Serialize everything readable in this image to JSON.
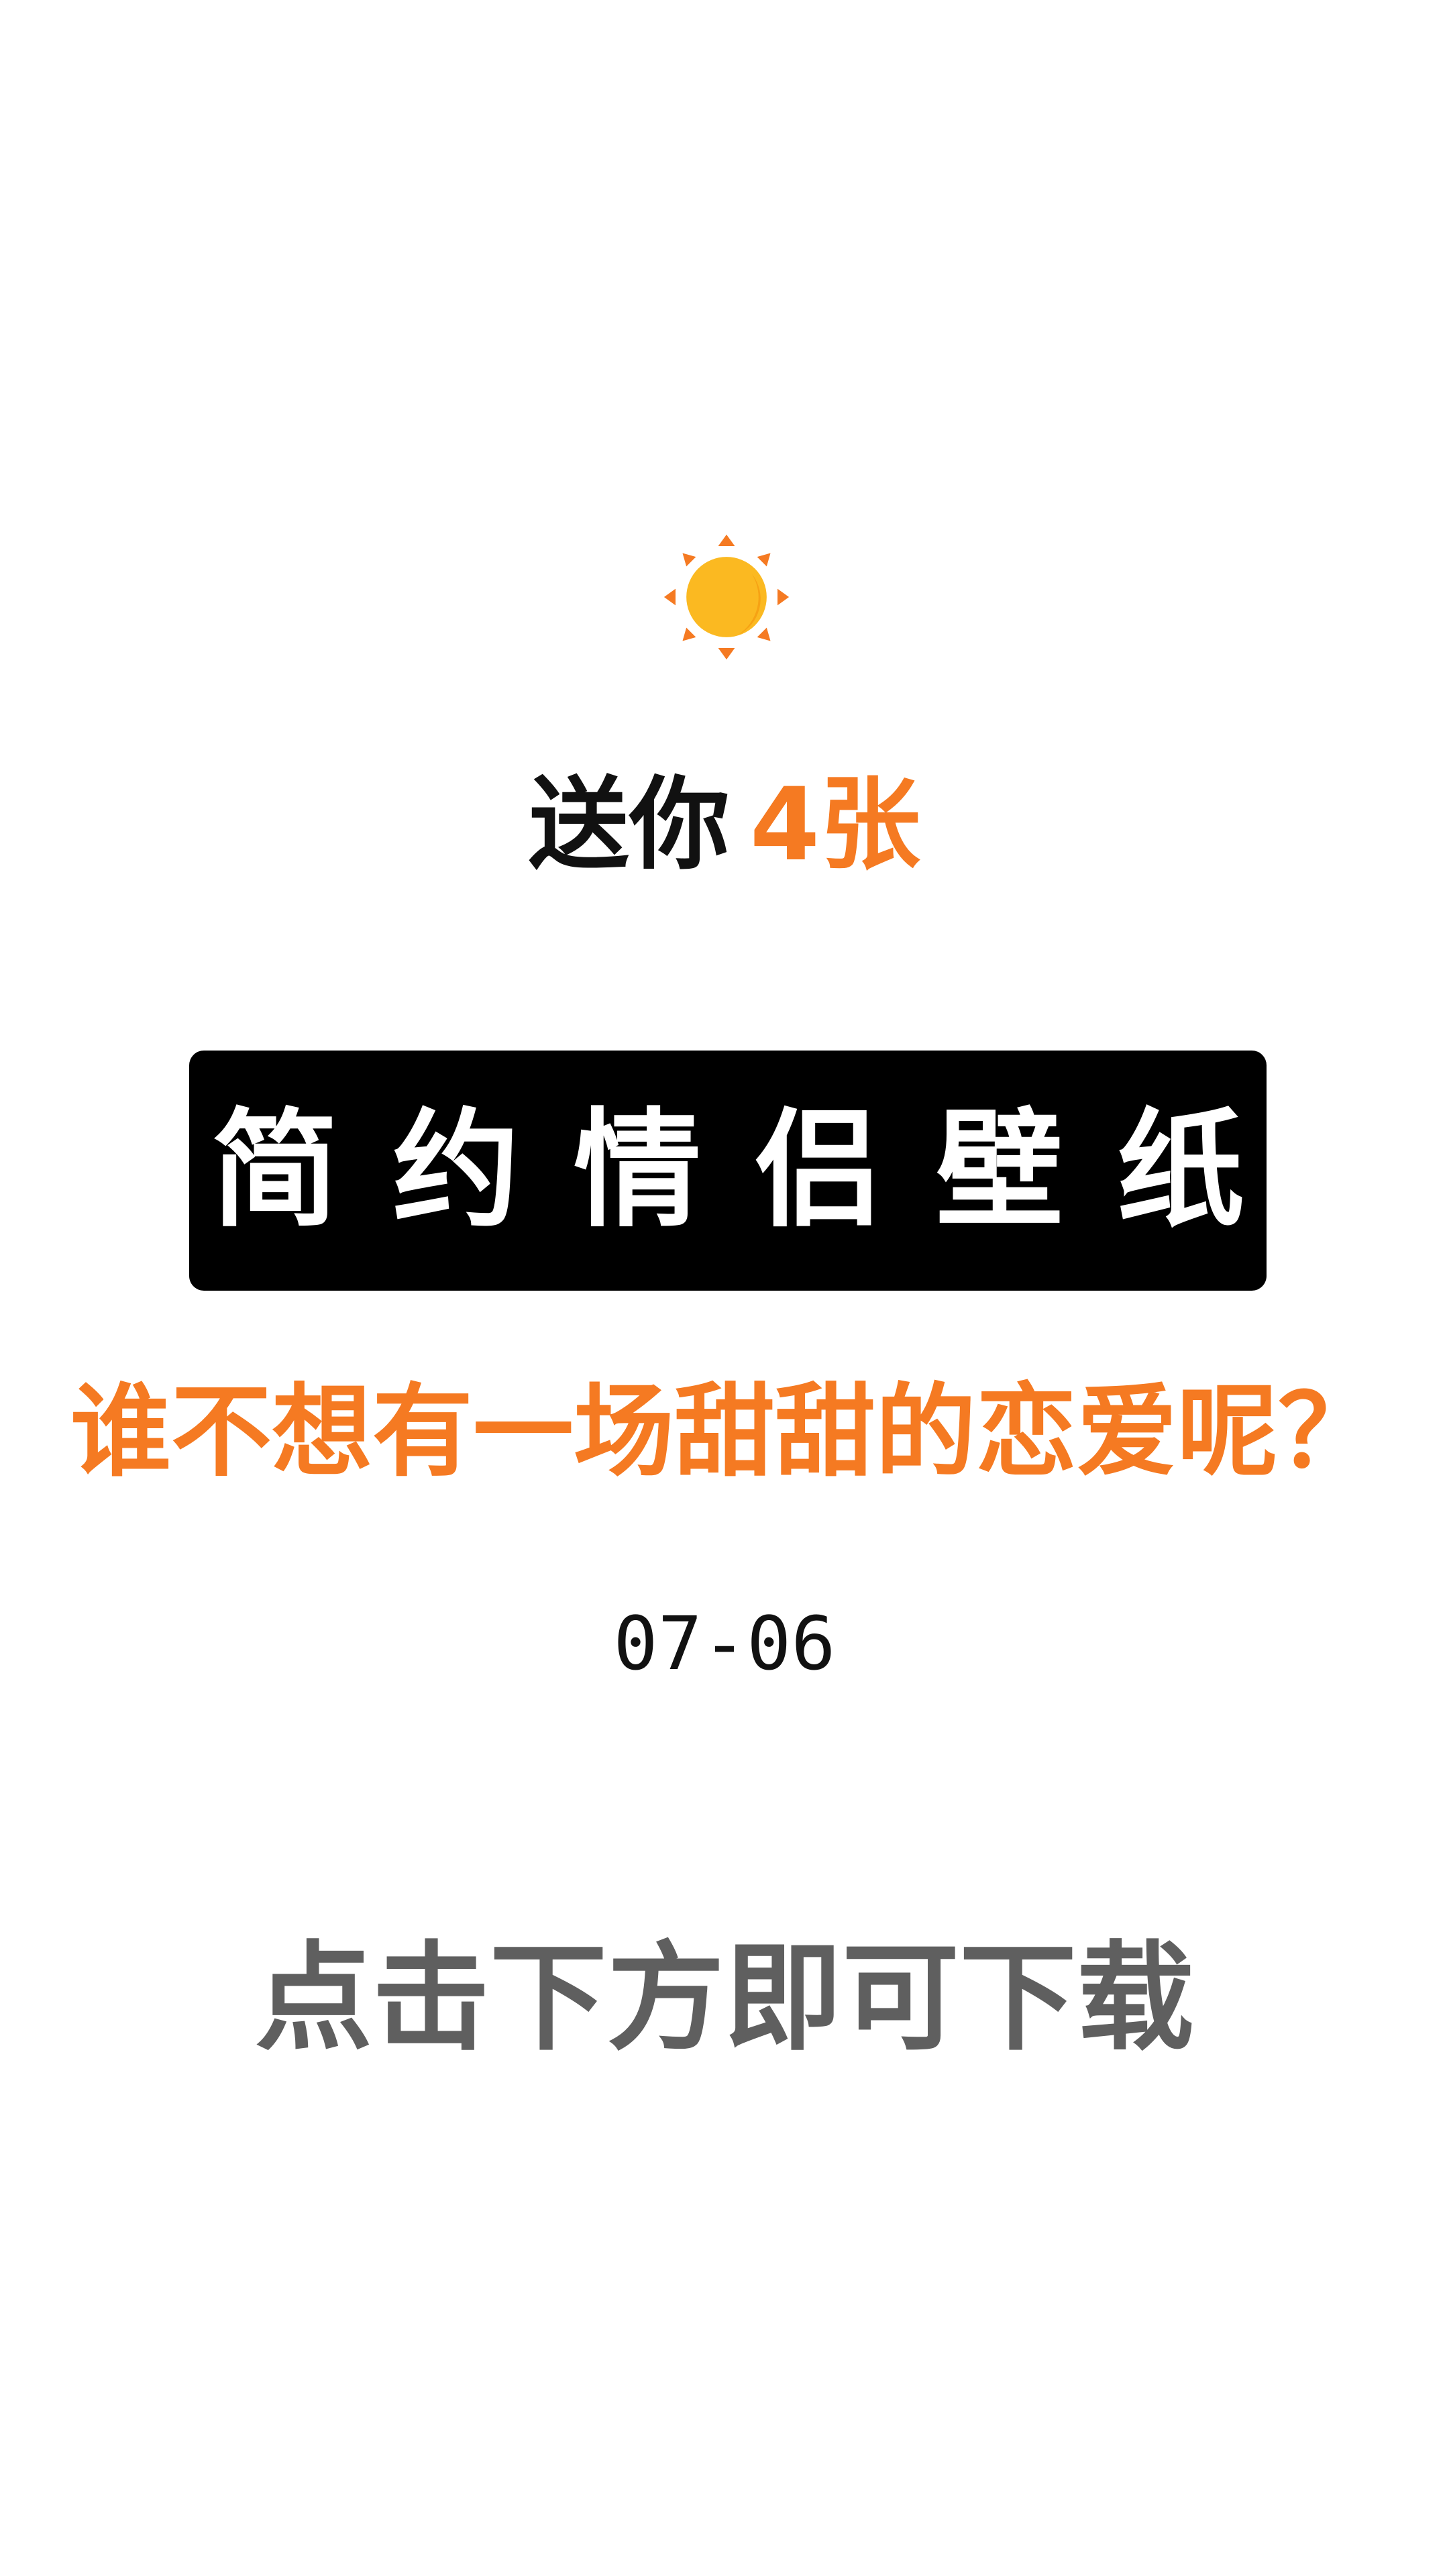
{
  "gift": {
    "prefix": "送你",
    "count": "4张"
  },
  "banner": {
    "title": "简约情侣壁纸"
  },
  "subtitle": "谁不想有一场甜甜的恋爱呢？",
  "date": "07-06",
  "cta": "点击下方即可下载",
  "icons": {
    "sun": "sun-icon"
  },
  "colors": {
    "accent": "#f57a22",
    "sun_core": "#fbb921",
    "text_dark": "#111111",
    "text_gray": "#5f5f5f",
    "banner_bg": "#000000",
    "background": "#ffffff"
  }
}
